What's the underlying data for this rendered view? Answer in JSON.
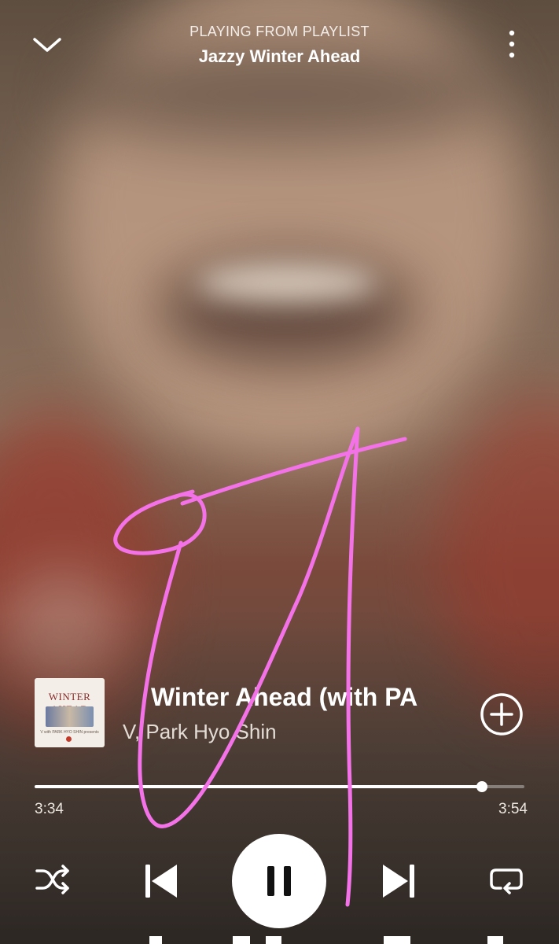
{
  "context": {
    "label": "PLAYING FROM PLAYLIST",
    "title": "Jazzy Winter Ahead"
  },
  "track": {
    "title": "Winter Ahead (with PA",
    "artist": "V, Park Hyo Shin",
    "cover": {
      "title": "WINTER AHEAD",
      "subtitle": "V with PARK HYO SHIN presents"
    }
  },
  "progress": {
    "elapsed": "3:34",
    "total": "3:54",
    "fraction": 0.914
  },
  "player": {
    "state": "playing"
  },
  "icons": {
    "collapse": "chevron-down-icon",
    "more": "more-vertical-icon",
    "add": "add-circle-icon",
    "shuffle": "shuffle-icon",
    "previous": "skip-previous-icon",
    "pause": "pause-icon",
    "next": "skip-next-icon",
    "repeat": "repeat-icon"
  },
  "colors": {
    "doodle": "#f472e8",
    "accent": "#ffffff"
  }
}
